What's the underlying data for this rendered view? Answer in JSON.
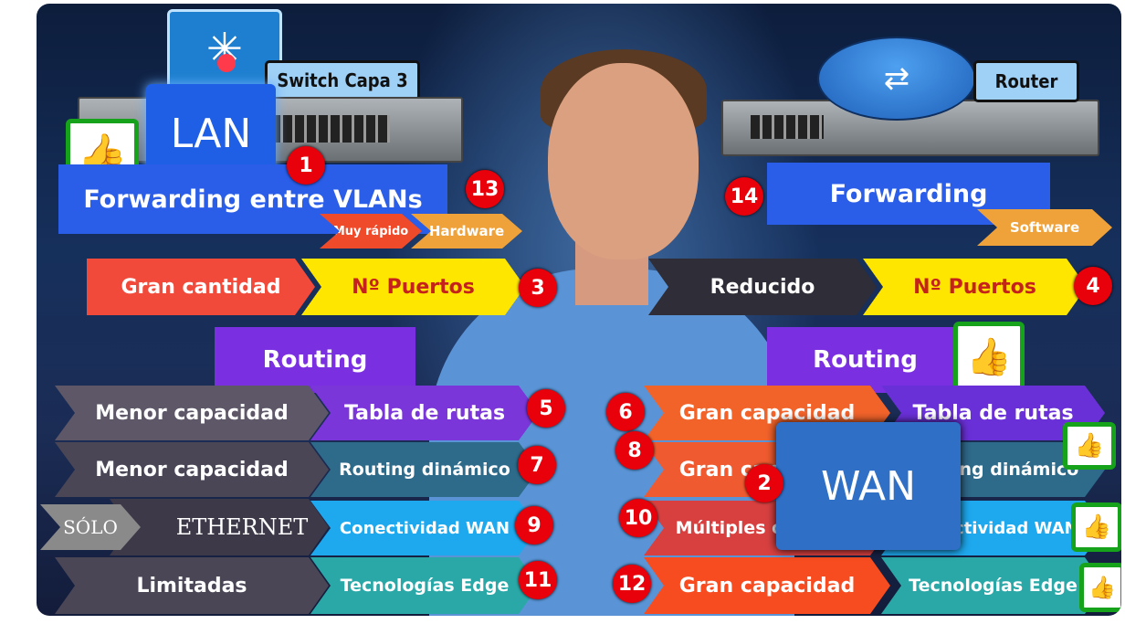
{
  "left": {
    "switch_label": "Switch Capa 3",
    "lan": "LAN",
    "forwarding": "Forwarding entre VLANs",
    "speed": "Muy rápido",
    "hardware": "Hardware",
    "ports_qty": "Gran cantidad",
    "ports": "Nº Puertos",
    "routing": "Routing",
    "rows": [
      {
        "a": "Menor capacidad",
        "b": "Tabla de rutas",
        "n": "5"
      },
      {
        "a": "Menor capacidad",
        "b": "Routing dinámico",
        "n": "7"
      },
      {
        "a_prefix": "SÓLO",
        "a": "ETHERNET",
        "b": "Conectividad WAN",
        "n": "9"
      },
      {
        "a": "Limitadas",
        "b": "Tecnologías Edge",
        "n": "11"
      }
    ]
  },
  "right": {
    "router_label": "Router",
    "wan": "WAN",
    "forwarding": "Forwarding",
    "software": "Software",
    "ports_qty": "Reducido",
    "ports": "Nº Puertos",
    "routing": "Routing",
    "rows": [
      {
        "a": "Gran capacidad",
        "b": "Tabla de rutas",
        "n": "6"
      },
      {
        "a": "Gran capacidad",
        "b": "Routing dinámico",
        "n": "8"
      },
      {
        "a": "Múltiples opciones",
        "b": "Conectividad WAN",
        "n": "10"
      },
      {
        "a": "Gran capacidad",
        "b": "Tecnologías Edge",
        "n": "12"
      }
    ]
  },
  "badges": {
    "lan": "1",
    "wan": "2",
    "left_ports": "3",
    "right_ports": "4",
    "left_fwd": "13",
    "right_fwd": "14"
  },
  "icons": {
    "thumbs": "thumbs-up-icon",
    "switch": "layer3-switch-icon",
    "router": "router-icon"
  },
  "colors": {
    "badge": "#e8000a",
    "thumb": "#16a21a",
    "yellow": "#ffe600",
    "purple": "#7a2fe0"
  }
}
